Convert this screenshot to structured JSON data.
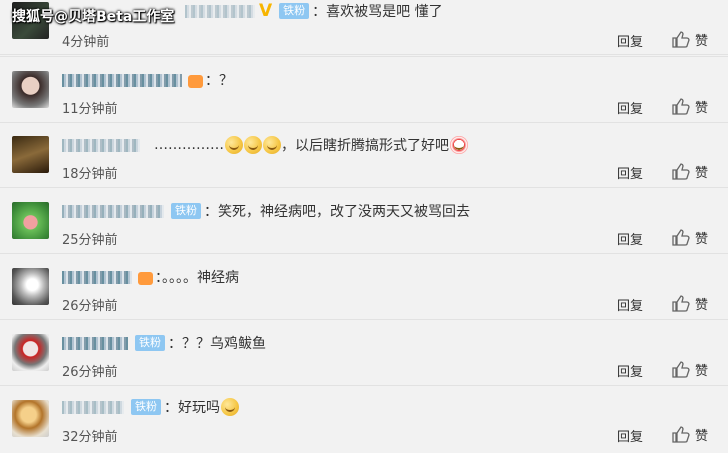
{
  "watermark": "搜狐号@贝塔Beta工作室",
  "comments": [
    {
      "badge": "铁粉",
      "text": "：喜欢被骂是吧 懂了",
      "time": "4分钟前",
      "reply": "回复",
      "like": "赞"
    },
    {
      "badge": "",
      "text": "：？",
      "time": "11分钟前",
      "reply": "回复",
      "like": "赞"
    },
    {
      "badge": "",
      "text": "……………",
      "text2": "，以后瞎折腾搞形式了好吧",
      "time": "18分钟前",
      "reply": "回复",
      "like": "赞"
    },
    {
      "badge": "铁粉",
      "text": "：笑死，神经病吧，改了没两天又被骂回去",
      "time": "25分钟前",
      "reply": "回复",
      "like": "赞"
    },
    {
      "badge": "",
      "text": "：。。。。神经病",
      "time": "26分钟前",
      "reply": "回复",
      "like": "赞"
    },
    {
      "badge": "铁粉",
      "text": "：？？乌鸡鲅鱼",
      "time": "26分钟前",
      "reply": "回复",
      "like": "赞"
    },
    {
      "badge": "铁粉",
      "text": "：好玩吗",
      "time": "32分钟前",
      "reply": "回复",
      "like": "赞"
    }
  ],
  "colors": {
    "badge": "#8ec7f2",
    "vip": "#f7b500",
    "background": "#f2f2f2"
  }
}
